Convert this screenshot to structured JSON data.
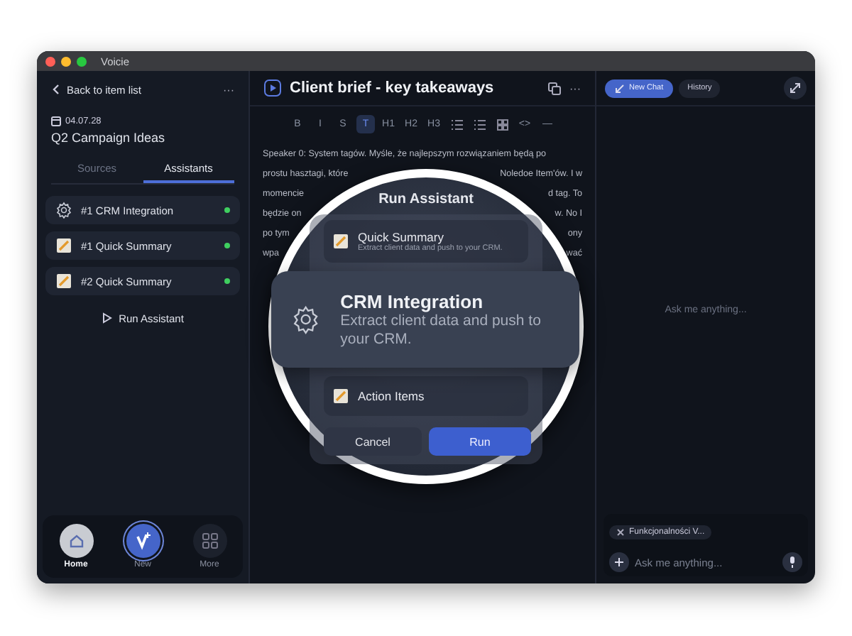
{
  "window": {
    "title": "Voicie"
  },
  "sidebar": {
    "back_label": "Back to item list",
    "more": "···",
    "date": "04.07.28",
    "title": "Q2 Campaign Ideas",
    "tabs": [
      {
        "label": "Sources",
        "selected": false
      },
      {
        "label": "Assistants",
        "selected": true
      }
    ],
    "assistants": [
      {
        "label": "#1 CRM Integration",
        "kind": "gear",
        "active": true
      },
      {
        "label": "#1 Quick Summary",
        "kind": "note",
        "active": true
      },
      {
        "label": "#2 Quick Summary",
        "kind": "note",
        "active": true
      }
    ],
    "run_label": "Run Assistant",
    "nav": [
      {
        "label": "Home",
        "kind": "home",
        "selected": true
      },
      {
        "label": "New",
        "kind": "new",
        "selected": false
      },
      {
        "label": "More",
        "kind": "grid",
        "selected": false
      }
    ]
  },
  "editor": {
    "title": "Client brief - key takeaways",
    "more": "···",
    "toolbar": [
      {
        "kind": "text",
        "label": "B",
        "selected": false
      },
      {
        "kind": "text",
        "label": "I",
        "selected": false
      },
      {
        "kind": "text",
        "label": "S",
        "selected": false
      },
      {
        "kind": "text",
        "label": "T",
        "selected": true
      },
      {
        "kind": "text",
        "label": "H1",
        "selected": false
      },
      {
        "kind": "text",
        "label": "H2",
        "selected": false
      },
      {
        "kind": "text",
        "label": "H3",
        "selected": false
      },
      {
        "kind": "bullets",
        "selected": false
      },
      {
        "kind": "numbers",
        "selected": false
      },
      {
        "kind": "grid",
        "selected": false
      },
      {
        "kind": "text",
        "label": "<>",
        "selected": false
      },
      {
        "kind": "text",
        "label": "—",
        "selected": false
      }
    ],
    "lines": [
      {
        "left": "Speaker 0: System tagów. Myśle, że najlepszym rozwiązaniem będą po"
      },
      {
        "left": "prostu hasztagi, które",
        "right": "Noledoe Item'ów. I w"
      },
      {
        "left": "momencie",
        "right": "d tag. To"
      },
      {
        "left": "będzie on",
        "right": "w. No I"
      },
      {
        "left": "po tym",
        "right": "ony"
      },
      {
        "left": "wpa",
        "right": "wać"
      }
    ]
  },
  "magnifier": {
    "title": "Run Assistant",
    "items": [
      {
        "kind": "note",
        "name": "Quick Summary",
        "description": "Extract client data and push to your CRM.",
        "selected": false
      },
      {
        "kind": "note",
        "name": "Action Items",
        "selected": false
      }
    ],
    "highlight": {
      "kind": "gear",
      "name": "CRM Integration",
      "description": "Extract client data and push to your CRM.",
      "selected": true
    },
    "cancel": "Cancel",
    "run": "Run"
  },
  "chat": {
    "new_chat": "New Chat",
    "history": "History",
    "empty_prompt": "Ask me anything...",
    "chip": "Funkcjonalności V...",
    "placeholder": "Ask me anything..."
  }
}
